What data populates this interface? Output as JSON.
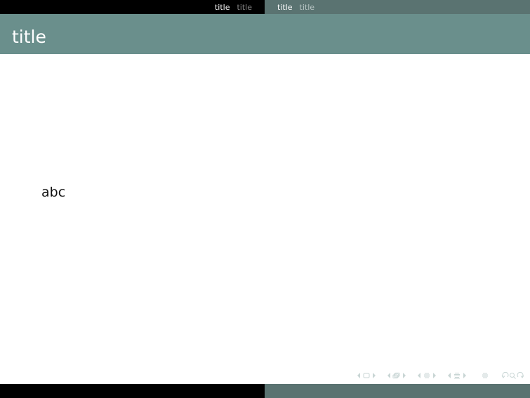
{
  "colors": {
    "headline_left_bg": "#000000",
    "headline_right_bg": "#5a7371",
    "frametitle_bg": "#6a8f8c",
    "nav_active": "#ffffff",
    "nav_inactive": "#b9c6c5",
    "nav_inactive_dark": "#8a8a8a",
    "frametitle_text": "#ffffff",
    "nav_symbol": "#c9d6d5",
    "footline_left_bg": "#000000",
    "footline_right_bg": "#5a7371"
  },
  "headline": {
    "left": [
      {
        "label": "title",
        "active": true
      },
      {
        "label": "title",
        "active": false
      }
    ],
    "right": [
      {
        "label": "title",
        "active": true
      },
      {
        "label": "title",
        "active": false
      }
    ]
  },
  "frame": {
    "title": "title",
    "body": "abc"
  },
  "navigation_symbols": [
    "slide-nav-icons",
    "frame-nav-icons",
    "subsection-nav-icons",
    "section-nav-icons",
    "appendix-icon",
    "search-and-back-icons"
  ]
}
